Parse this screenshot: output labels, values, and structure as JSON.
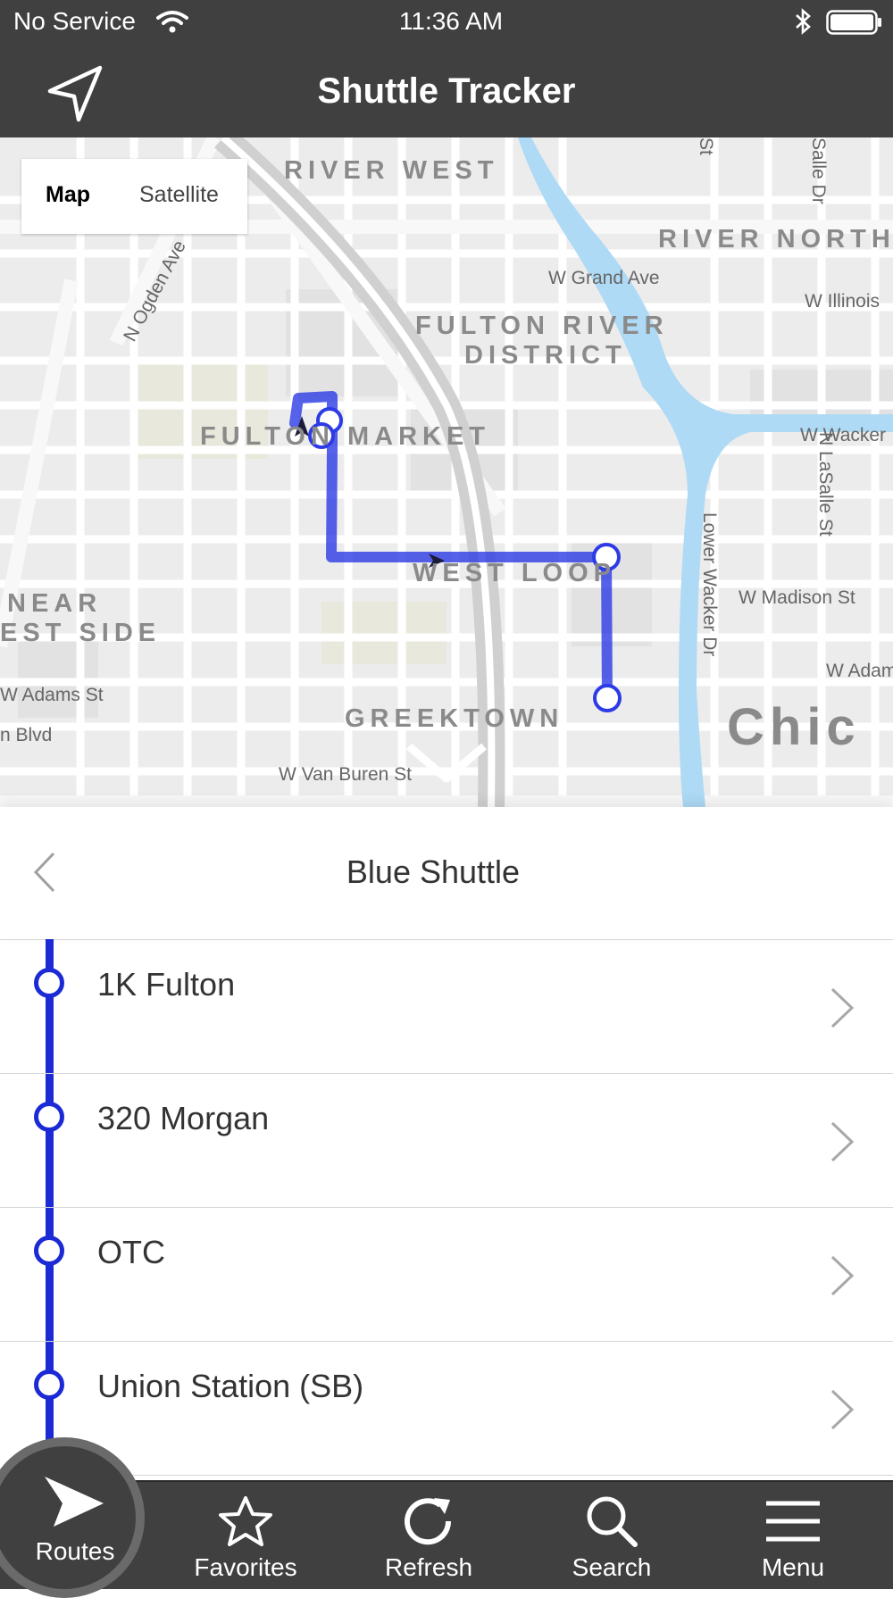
{
  "status_bar": {
    "carrier": "No Service",
    "time": "11:36 AM"
  },
  "nav": {
    "title": "Shuttle Tracker"
  },
  "map": {
    "type_toggle": {
      "map_label": "Map",
      "satellite_label": "Satellite",
      "selected": "Map"
    },
    "neighborhoods": [
      "RIVER WEST",
      "RIVER NORTH",
      "FULTON RIVER",
      "DISTRICT",
      "FULTON MARKET",
      "WEST LOOP",
      "GREEKTOWN",
      "NEAR",
      "EST SIDE",
      "Chic"
    ],
    "streets": [
      "W Grand Ave",
      "N Ogden Ave",
      "W Illinois",
      "W Wacker",
      "N LaSalle St",
      "Lower Wacker Dr",
      "W Madison St",
      "W Adam",
      "W Adams St",
      "n Blvd",
      "W Van Buren St",
      "St",
      "Salle Dr"
    ],
    "route_color": "#2d3be6"
  },
  "route_detail": {
    "title": "Blue Shuttle",
    "line_color": "#1c2ad6",
    "stops": [
      {
        "name": "1K Fulton"
      },
      {
        "name": "320 Morgan"
      },
      {
        "name": "OTC"
      },
      {
        "name": "Union Station (SB)"
      }
    ]
  },
  "tab_bar": {
    "active": "Routes",
    "tabs": [
      {
        "label": "Routes",
        "icon": "routes-arrow-icon"
      },
      {
        "label": "Favorites",
        "icon": "star-icon"
      },
      {
        "label": "Refresh",
        "icon": "refresh-icon"
      },
      {
        "label": "Search",
        "icon": "search-icon"
      },
      {
        "label": "Menu",
        "icon": "menu-icon"
      }
    ]
  }
}
